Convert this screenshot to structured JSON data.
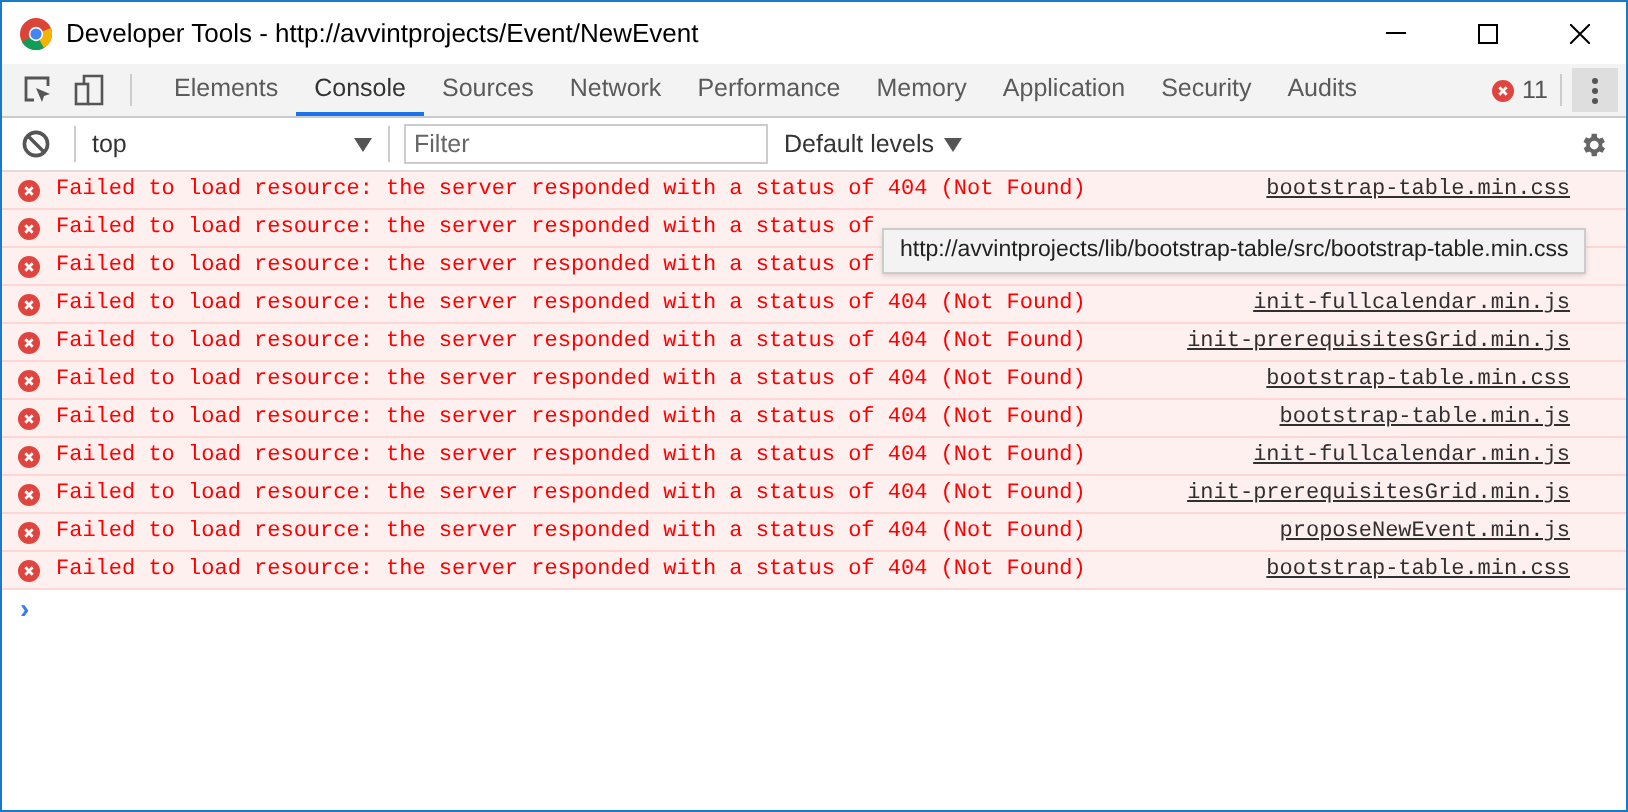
{
  "window": {
    "title": "Developer Tools - http://avvintprojects/Event/NewEvent"
  },
  "tabs": [
    {
      "label": "Elements",
      "selected": false
    },
    {
      "label": "Console",
      "selected": true
    },
    {
      "label": "Sources",
      "selected": false
    },
    {
      "label": "Network",
      "selected": false
    },
    {
      "label": "Performance",
      "selected": false
    },
    {
      "label": "Memory",
      "selected": false
    },
    {
      "label": "Application",
      "selected": false
    },
    {
      "label": "Security",
      "selected": false
    },
    {
      "label": "Audits",
      "selected": false
    }
  ],
  "error_count": "11",
  "console_toolbar": {
    "context": "top",
    "filter": {
      "placeholder": "Filter"
    },
    "levels": "Default levels"
  },
  "messages": [
    {
      "text": "Failed to load resource: the server responded with a status of 404 (Not Found)",
      "source": "bootstrap-table.min.css"
    },
    {
      "text": "Failed to load resource: the server responded with a status of"
    },
    {
      "text": "Failed to load resource: the server responded with a status of"
    },
    {
      "text": "Failed to load resource: the server responded with a status of 404 (Not Found)",
      "source": "init-fullcalendar.min.js"
    },
    {
      "text": "Failed to load resource: the server responded with a status of 404 (Not Found)",
      "source": "init-prerequisitesGrid.min.js"
    },
    {
      "text": "Failed to load resource: the server responded with a status of 404 (Not Found)",
      "source": "bootstrap-table.min.css"
    },
    {
      "text": "Failed to load resource: the server responded with a status of 404 (Not Found)",
      "source": "bootstrap-table.min.js"
    },
    {
      "text": "Failed to load resource: the server responded with a status of 404 (Not Found)",
      "source": "init-fullcalendar.min.js"
    },
    {
      "text": "Failed to load resource: the server responded with a status of 404 (Not Found)",
      "source": "init-prerequisitesGrid.min.js"
    },
    {
      "text": "Failed to load resource: the server responded with a status of 404 (Not Found)",
      "source": "proposeNewEvent.min.js"
    },
    {
      "text": "Failed to load resource: the server responded with a status of 404 (Not Found)",
      "source": "bootstrap-table.min.css"
    }
  ],
  "prompt": "›",
  "tooltip": "http://avvintprojects/lib/bootstrap-table/src/bootstrap-table.min.css"
}
